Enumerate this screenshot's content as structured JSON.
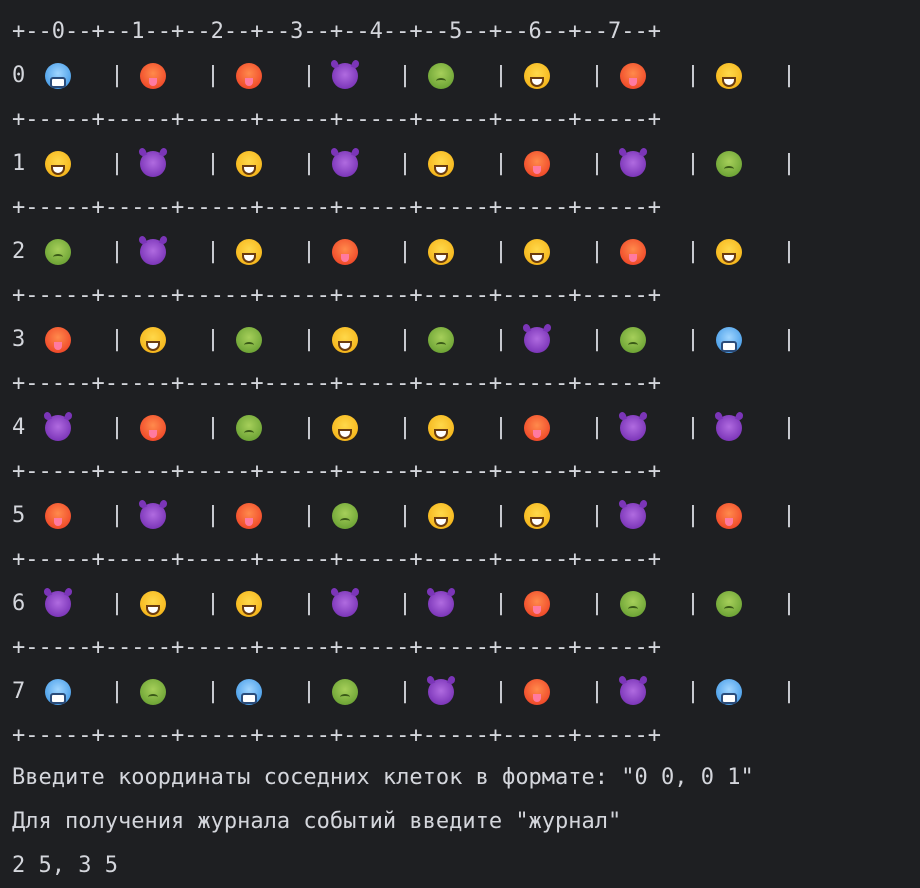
{
  "board": {
    "header": "+--0--+--1--+--2--+--3--+--4--+--5--+--6--+--7--+",
    "separator": "+-----+-----+-----+-----+-----+-----+-----+-----+",
    "pipe": "|",
    "rows": [
      {
        "index": "0",
        "cells": [
          "cold-face-icon",
          "hot-face-icon",
          "hot-face-icon",
          "devil-face-icon",
          "sick-face-icon",
          "grin-face-icon",
          "hot-face-icon",
          "grin-face-icon"
        ]
      },
      {
        "index": "1",
        "cells": [
          "grin-face-icon",
          "devil-face-icon",
          "grin-face-icon",
          "devil-face-icon",
          "grin-face-icon",
          "hot-face-icon",
          "devil-face-icon",
          "sick-face-icon"
        ]
      },
      {
        "index": "2",
        "cells": [
          "sick-face-icon",
          "devil-face-icon",
          "grin-face-icon",
          "hot-face-icon",
          "grin-face-icon",
          "grin-face-icon",
          "hot-face-icon",
          "grin-face-icon"
        ]
      },
      {
        "index": "3",
        "cells": [
          "hot-face-icon",
          "grin-face-icon",
          "sick-face-icon",
          "grin-face-icon",
          "sick-face-icon",
          "devil-face-icon",
          "sick-face-icon",
          "cold-face-icon"
        ]
      },
      {
        "index": "4",
        "cells": [
          "devil-face-icon",
          "hot-face-icon",
          "sick-face-icon",
          "grin-face-icon",
          "grin-face-icon",
          "hot-face-icon",
          "devil-face-icon",
          "devil-face-icon"
        ]
      },
      {
        "index": "5",
        "cells": [
          "hot-face-icon",
          "devil-face-icon",
          "hot-face-icon",
          "sick-face-icon",
          "grin-face-icon",
          "grin-face-icon",
          "devil-face-icon",
          "hot-face-icon"
        ]
      },
      {
        "index": "6",
        "cells": [
          "devil-face-icon",
          "grin-face-icon",
          "grin-face-icon",
          "devil-face-icon",
          "devil-face-icon",
          "hot-face-icon",
          "sick-face-icon",
          "sick-face-icon"
        ]
      },
      {
        "index": "7",
        "cells": [
          "cold-face-icon",
          "sick-face-icon",
          "cold-face-icon",
          "sick-face-icon",
          "devil-face-icon",
          "hot-face-icon",
          "devil-face-icon",
          "cold-face-icon"
        ]
      }
    ]
  },
  "console": {
    "prompt_coordinates": "Введите координаты соседних клеток в формате: \"0 0, 0 1\"",
    "prompt_log": "Для получения журнала событий введите \"журнал\"",
    "user_input": "2 5, 3 5"
  },
  "colors": {
    "background": "#1e1f22",
    "text": "#d4d6dc"
  }
}
